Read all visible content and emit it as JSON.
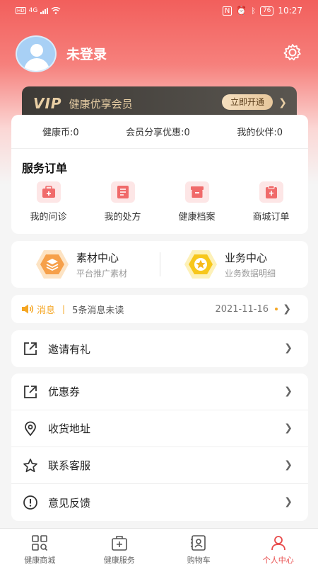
{
  "status": {
    "network": "4G",
    "time": "10:27",
    "battery": "76"
  },
  "profile": {
    "username": "未登录"
  },
  "vip": {
    "logo": "VIP",
    "title": "健康优享会员",
    "button": "立即开通"
  },
  "stats": {
    "coins": "健康币:0",
    "share_discount": "会员分享优惠:0",
    "partners": "我的伙伴:0"
  },
  "orders": {
    "title": "服务订单",
    "items": [
      {
        "label": "我的问诊",
        "icon": "consult-icon"
      },
      {
        "label": "我的处方",
        "icon": "prescription-icon"
      },
      {
        "label": "健康档案",
        "icon": "archive-icon"
      },
      {
        "label": "商城订单",
        "icon": "mall-order-icon"
      }
    ]
  },
  "centers": [
    {
      "title": "素材中心",
      "subtitle": "平台推广素材",
      "icon": "layers-hex-icon"
    },
    {
      "title": "业务中心",
      "subtitle": "业务数据明细",
      "icon": "star-hex-icon"
    }
  ],
  "message": {
    "tag": "消息",
    "sep": "|",
    "text": "5条消息未读",
    "date": "2021-11-16"
  },
  "menu_invite": [
    {
      "label": "邀请有礼",
      "icon": "share-icon"
    }
  ],
  "menu_main": [
    {
      "label": "优惠券",
      "icon": "coupon-icon"
    },
    {
      "label": "收货地址",
      "icon": "location-icon"
    },
    {
      "label": "联系客服",
      "icon": "star-outline-icon"
    },
    {
      "label": "意见反馈",
      "icon": "feedback-icon"
    }
  ],
  "tabs": [
    {
      "label": "健康商城",
      "icon": "mall-icon"
    },
    {
      "label": "健康服务",
      "icon": "service-icon"
    },
    {
      "label": "购物车",
      "icon": "cart-icon"
    },
    {
      "label": "个人中心",
      "icon": "profile-icon"
    }
  ],
  "colors": {
    "accent": "#e84b4b",
    "orange": "#f5a623",
    "vip_gold": "#e9cfa5"
  }
}
